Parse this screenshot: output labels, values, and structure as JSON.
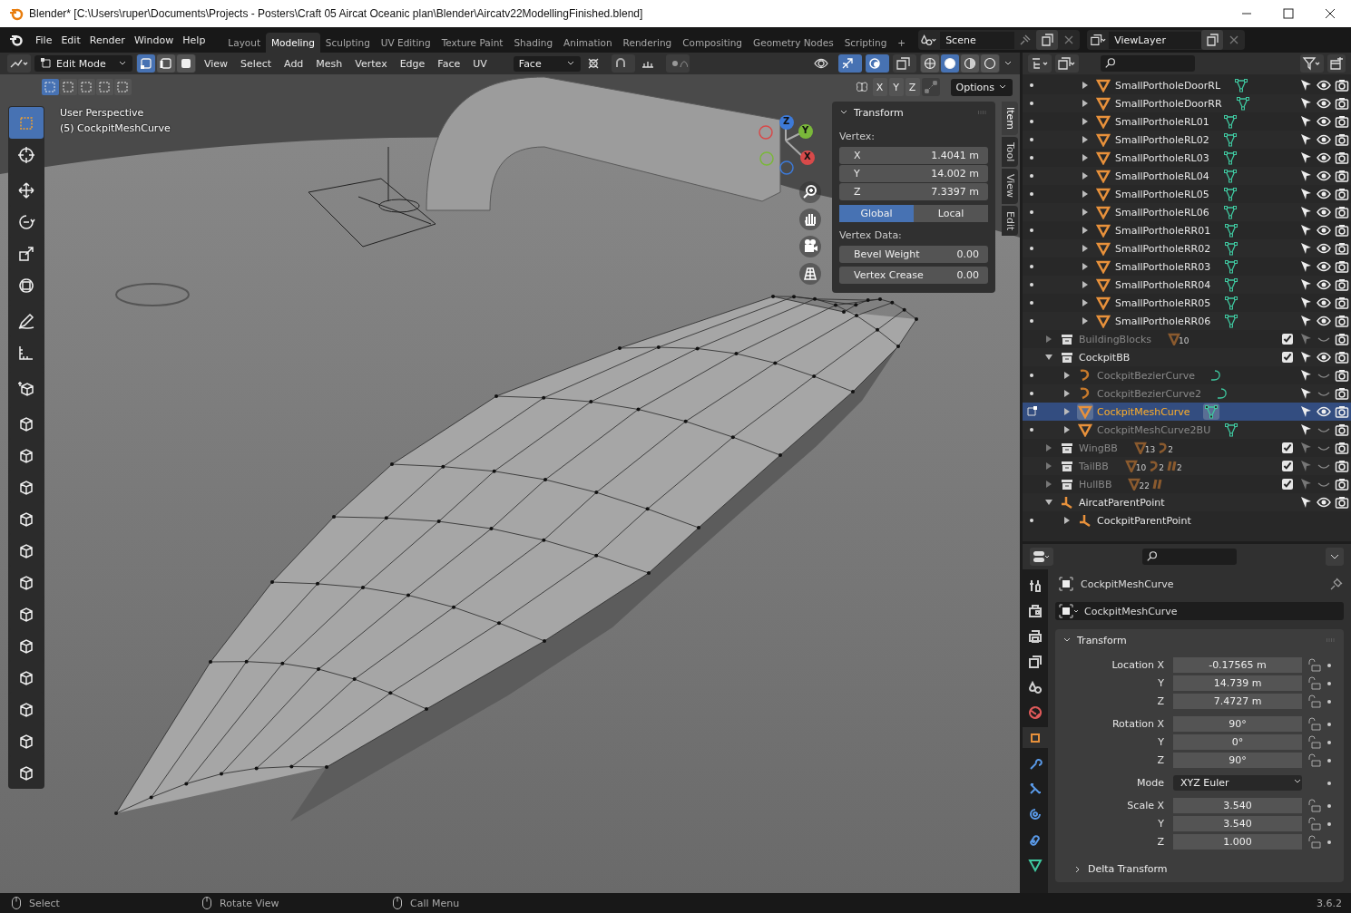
{
  "window": {
    "title": "Blender* [C:\\Users\\ruper\\Documents\\Projects - Posters\\Craft 05 Aircat Oceanic plan\\Blender\\Aircatv22ModellingFinished.blend]"
  },
  "menu": [
    "File",
    "Edit",
    "Render",
    "Window",
    "Help"
  ],
  "workspaces": [
    {
      "label": "Layout",
      "selected": false
    },
    {
      "label": "Modeling",
      "selected": true
    },
    {
      "label": "Sculpting",
      "selected": false
    },
    {
      "label": "UV Editing",
      "selected": false
    },
    {
      "label": "Texture Paint",
      "selected": false
    },
    {
      "label": "Shading",
      "selected": false
    },
    {
      "label": "Animation",
      "selected": false
    },
    {
      "label": "Rendering",
      "selected": false
    },
    {
      "label": "Compositing",
      "selected": false
    },
    {
      "label": "Geometry Nodes",
      "selected": false
    },
    {
      "label": "Scripting",
      "selected": false
    }
  ],
  "add_workspace": "+",
  "scene": {
    "value": "Scene"
  },
  "view_layer": {
    "value": "ViewLayer"
  },
  "viewport": {
    "mode": "Edit Mode",
    "select_modes": [
      {
        "kind": "vertex",
        "selected": true
      },
      {
        "kind": "edge",
        "selected": false
      },
      {
        "kind": "face",
        "selected": false
      }
    ],
    "menus": [
      "View",
      "Select",
      "Add",
      "Mesh",
      "Vertex",
      "Edge",
      "Face",
      "UV"
    ],
    "orientation": "Face",
    "shading": [
      {
        "kind": "wireframe",
        "selected": false
      },
      {
        "kind": "solid",
        "selected": true
      },
      {
        "kind": "material",
        "selected": false
      },
      {
        "kind": "rendered",
        "selected": false
      }
    ],
    "box_modes": [
      {
        "selected": true
      },
      {
        "selected": false
      },
      {
        "selected": false
      },
      {
        "selected": false
      },
      {
        "selected": false
      }
    ],
    "mirror_axes": [
      "X",
      "Y",
      "Z"
    ],
    "options": "Options",
    "overlay_text": [
      "User Perspective",
      "(5) CockpitMeshCurve"
    ],
    "tool_groups": [
      {
        "tools": [
          {
            "kind": "select",
            "selected": true
          },
          {
            "kind": "cursor",
            "selected": false
          }
        ]
      },
      {
        "tools": [
          {
            "kind": "move",
            "selected": false
          },
          {
            "kind": "rotate",
            "selected": false
          },
          {
            "kind": "scale",
            "selected": false
          },
          {
            "kind": "transform",
            "selected": false
          }
        ]
      },
      {
        "tools": [
          {
            "kind": "annotate",
            "selected": false
          },
          {
            "kind": "measure",
            "selected": false
          }
        ]
      },
      {
        "tools": [
          {
            "kind": "add_cube",
            "selected": false
          }
        ]
      },
      {
        "tools": [
          {
            "kind": "extrude",
            "selected": false
          },
          {
            "kind": "inset",
            "selected": false
          },
          {
            "kind": "bevel",
            "selected": false
          },
          {
            "kind": "loop_cut",
            "selected": false
          },
          {
            "kind": "knife",
            "selected": false
          },
          {
            "kind": "poly_build",
            "selected": false
          },
          {
            "kind": "spin",
            "selected": false
          },
          {
            "kind": "smooth",
            "selected": false
          },
          {
            "kind": "edge_slide",
            "selected": false
          },
          {
            "kind": "shrink",
            "selected": false
          },
          {
            "kind": "shear",
            "selected": false
          },
          {
            "kind": "rip",
            "selected": false
          }
        ]
      }
    ],
    "gizmo_axes": [
      "Z",
      "Y",
      "X"
    ],
    "sidebar_tabs": [
      {
        "label": "Item",
        "selected": true
      },
      {
        "label": "Tool",
        "selected": false
      },
      {
        "label": "View",
        "selected": false
      },
      {
        "label": "Edit",
        "selected": false
      }
    ],
    "n_panel": {
      "title": "Transform",
      "vertex_label": "Vertex:",
      "coords": [
        {
          "axis": "X",
          "value": "1.4041 m"
        },
        {
          "axis": "Y",
          "value": "14.002 m"
        },
        {
          "axis": "Z",
          "value": "7.3397 m"
        }
      ],
      "space": [
        {
          "label": "Global",
          "selected": true
        },
        {
          "label": "Local",
          "selected": false
        }
      ],
      "data_label": "Vertex Data:",
      "data": [
        {
          "label": "Bevel Weight",
          "value": "0.00"
        },
        {
          "label": "Vertex Crease",
          "value": "0.00"
        }
      ]
    }
  },
  "outliner": {
    "continued_rows": [
      {
        "name": "SmallPortholeDoorRL",
        "kind": "mesh",
        "selected": false,
        "visible": true,
        "expanded": false
      },
      {
        "name": "SmallPortholeDoorRR",
        "kind": "mesh",
        "selected": false,
        "visible": true,
        "expanded": false
      },
      {
        "name": "SmallPortholeRL01",
        "kind": "mesh",
        "selected": false,
        "visible": true,
        "expanded": false
      },
      {
        "name": "SmallPortholeRL02",
        "kind": "mesh",
        "selected": false,
        "visible": true,
        "expanded": false
      },
      {
        "name": "SmallPortholeRL03",
        "kind": "mesh",
        "selected": false,
        "visible": true,
        "expanded": false
      },
      {
        "name": "SmallPortholeRL04",
        "kind": "mesh",
        "selected": false,
        "visible": true,
        "expanded": false
      },
      {
        "name": "SmallPortholeRL05",
        "kind": "mesh",
        "selected": false,
        "visible": true,
        "expanded": false
      },
      {
        "name": "SmallPortholeRL06",
        "kind": "mesh",
        "selected": false,
        "visible": true,
        "expanded": false
      },
      {
        "name": "SmallPortholeRR01",
        "kind": "mesh",
        "selected": false,
        "visible": true,
        "expanded": false
      },
      {
        "name": "SmallPortholeRR02",
        "kind": "mesh",
        "selected": false,
        "visible": true,
        "expanded": false
      },
      {
        "name": "SmallPortholeRR03",
        "kind": "mesh",
        "selected": false,
        "visible": true,
        "expanded": false
      },
      {
        "name": "SmallPortholeRR04",
        "kind": "mesh",
        "selected": false,
        "visible": true,
        "expanded": false
      },
      {
        "name": "SmallPortholeRR05",
        "kind": "mesh",
        "selected": false,
        "visible": true,
        "expanded": false
      },
      {
        "name": "SmallPortholeRR06",
        "kind": "mesh",
        "selected": false,
        "visible": true,
        "expanded": false
      }
    ],
    "items": [
      {
        "name": "BuildingBlocks",
        "kind": "collection",
        "selected": false,
        "visible": false,
        "expanded": false,
        "checked": true,
        "counts": [
          {
            "kind": "mesh",
            "count": "10"
          }
        ]
      },
      {
        "name": "CockpitBB",
        "kind": "collection",
        "selected": false,
        "visible": true,
        "expanded": true,
        "checked": true,
        "children": [
          {
            "name": "CockpitBezierCurve",
            "kind": "curve",
            "selected": false,
            "visible": false,
            "expanded": false
          },
          {
            "name": "CockpitBezierCurve2",
            "kind": "curve",
            "selected": false,
            "visible": false,
            "expanded": false
          },
          {
            "name": "CockpitMeshCurve",
            "kind": "mesh",
            "selected": true,
            "visible": true,
            "expanded": false
          },
          {
            "name": "CockpitMeshCurve2BU",
            "kind": "mesh",
            "selected": false,
            "visible": false,
            "expanded": false
          }
        ]
      },
      {
        "name": "WingBB",
        "kind": "collection",
        "selected": false,
        "visible": false,
        "expanded": false,
        "checked": true,
        "counts": [
          {
            "kind": "mesh",
            "count": "13"
          },
          {
            "kind": "curve",
            "count": "2"
          }
        ]
      },
      {
        "name": "TailBB",
        "kind": "collection",
        "selected": false,
        "visible": false,
        "expanded": false,
        "checked": true,
        "counts": [
          {
            "kind": "mesh",
            "count": "10"
          },
          {
            "kind": "curve",
            "count": "2"
          },
          {
            "kind": "lattice",
            "count": "2"
          }
        ]
      },
      {
        "name": "HullBB",
        "kind": "collection",
        "selected": false,
        "visible": false,
        "expanded": false,
        "checked": true,
        "counts": [
          {
            "kind": "mesh",
            "count": "22"
          },
          {
            "kind": "lattice"
          }
        ]
      },
      {
        "name": "AircatParentPoint",
        "kind": "empty",
        "selected": false,
        "visible": true,
        "expanded": true,
        "children": [
          {
            "name": "CockpitParentPoint",
            "kind": "empty",
            "selected": false,
            "expanded": false
          }
        ]
      }
    ]
  },
  "properties": {
    "tabs": [
      {
        "kind": "tool",
        "selected": false
      },
      {
        "kind": "render",
        "selected": false
      },
      {
        "kind": "output",
        "selected": false
      },
      {
        "kind": "view_layer",
        "selected": false
      },
      {
        "kind": "scene",
        "selected": false
      },
      {
        "kind": "world",
        "selected": false
      },
      {
        "kind": "object",
        "selected": true
      },
      {
        "kind": "modifiers",
        "selected": false
      },
      {
        "kind": "particles",
        "selected": false
      },
      {
        "kind": "physics",
        "selected": false
      },
      {
        "kind": "constraints",
        "selected": false
      },
      {
        "kind": "data",
        "selected": false
      }
    ],
    "object_name": "CockpitMeshCurve",
    "datablock": "CockpitMeshCurve",
    "panel": {
      "title": "Transform",
      "groups": [
        {
          "rows": [
            {
              "kind": "number",
              "label": "Location X",
              "value": "-0.17565 m"
            },
            {
              "kind": "number",
              "label": "Y",
              "value": "14.739 m"
            },
            {
              "kind": "number",
              "label": "Z",
              "value": "7.4727 m"
            }
          ]
        },
        {
          "rows": [
            {
              "kind": "number",
              "label": "Rotation X",
              "value": "90°"
            },
            {
              "kind": "number",
              "label": "Y",
              "value": "0°"
            },
            {
              "kind": "number",
              "label": "Z",
              "value": "90°"
            }
          ]
        },
        {
          "rows": [
            {
              "kind": "enum",
              "label": "Mode",
              "value": "XYZ Euler"
            }
          ]
        },
        {
          "rows": [
            {
              "kind": "number",
              "label": "Scale X",
              "value": "3.540"
            },
            {
              "kind": "number",
              "label": "Y",
              "value": "3.540"
            },
            {
              "kind": "number",
              "label": "Z",
              "value": "1.000"
            }
          ]
        }
      ]
    },
    "collapsed_panel": "Delta Transform"
  },
  "status_bar": {
    "hints": [
      "Select",
      "Rotate View",
      "Call Menu"
    ],
    "version": "3.6.2"
  }
}
